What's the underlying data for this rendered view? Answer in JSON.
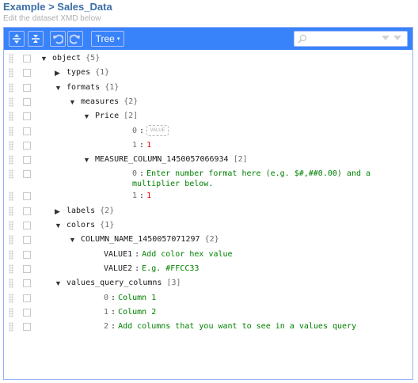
{
  "header": {
    "breadcrumb": "Example > Sales_Data",
    "subtitle": "Edit the dataset XMD below"
  },
  "menu": {
    "expand_all_icon": "expand-all-icon",
    "collapse_all_icon": "collapse-all-icon",
    "undo_icon": "undo-icon",
    "redo_icon": "redo-icon",
    "mode_label": "Tree",
    "mode_caret": "▾",
    "search": {
      "value": "",
      "placeholder": ""
    }
  },
  "colors": {
    "accent": "#3883fa",
    "string": "#008000",
    "number": "#ee0000"
  },
  "tree": [
    {
      "depth": 0,
      "toggle": "▼",
      "key": "object",
      "count": "{5}"
    },
    {
      "depth": 1,
      "toggle": "▶",
      "key": "types",
      "count": "{1}"
    },
    {
      "depth": 1,
      "toggle": "▼",
      "key": "formats",
      "count": "{1}"
    },
    {
      "depth": 2,
      "toggle": "▼",
      "key": "measures",
      "count": "{2}"
    },
    {
      "depth": 3,
      "toggle": "▼",
      "key": "Price",
      "count": "[2]"
    },
    {
      "depth": 4,
      "index": "0",
      "empty": "VALUE"
    },
    {
      "depth": 4,
      "index": "1",
      "value": "1",
      "type": "number"
    },
    {
      "depth": 3,
      "toggle": "▼",
      "key": "MEASURE_COLUMN_1450057066934",
      "count": "[2]"
    },
    {
      "depth": 4,
      "index": "0",
      "value": "Enter number format here (e.g. $#,##0.00) and a multiplier below.",
      "type": "string",
      "multiline": true
    },
    {
      "depth": 4,
      "index": "1",
      "value": "1",
      "type": "number"
    },
    {
      "depth": 1,
      "toggle": "▶",
      "key": "labels",
      "count": "{2}"
    },
    {
      "depth": 1,
      "toggle": "▼",
      "key": "colors",
      "count": "{1}"
    },
    {
      "depth": 2,
      "toggle": "▼",
      "key": "COLUMN_NAME_1450057071297",
      "count": "{2}"
    },
    {
      "depth": 3,
      "key": "VALUE1",
      "value": "Add color hex value",
      "type": "string"
    },
    {
      "depth": 3,
      "key": "VALUE2",
      "value": "E.g. #FFCC33",
      "type": "string"
    },
    {
      "depth": 1,
      "toggle": "▼",
      "key": "values_query_columns",
      "count": "[3]"
    },
    {
      "depth": 2,
      "index": "0",
      "value": "Column 1",
      "type": "string"
    },
    {
      "depth": 2,
      "index": "1",
      "value": "Column 2",
      "type": "string"
    },
    {
      "depth": 2,
      "index": "2",
      "value": "Add columns that you want to see in a values query",
      "type": "string"
    }
  ]
}
